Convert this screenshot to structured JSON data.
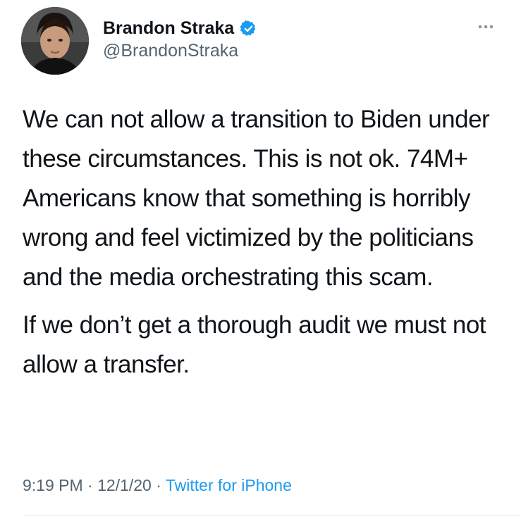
{
  "author": {
    "display_name": "Brandon Straka",
    "handle": "@BrandonStraka",
    "verified": true,
    "avatar_icon": "profile-photo"
  },
  "tweet": {
    "paragraphs": [
      "We can not allow a transition to Biden under these circumstances. This is not ok. 74M+ Americans know that something is horribly wrong and feel victimized by the politicians and the media orchestrating this scam.",
      "If we don’t get a thorough audit we must not allow a transfer."
    ]
  },
  "meta": {
    "time": "9:19 PM",
    "separator": "·",
    "date": "12/1/20",
    "source": "Twitter for iPhone"
  },
  "colors": {
    "text": "#0f1419",
    "secondary": "#536471",
    "accent": "#1d9bf0"
  },
  "icons": {
    "more": "more-icon",
    "verified": "verified-badge-icon"
  }
}
